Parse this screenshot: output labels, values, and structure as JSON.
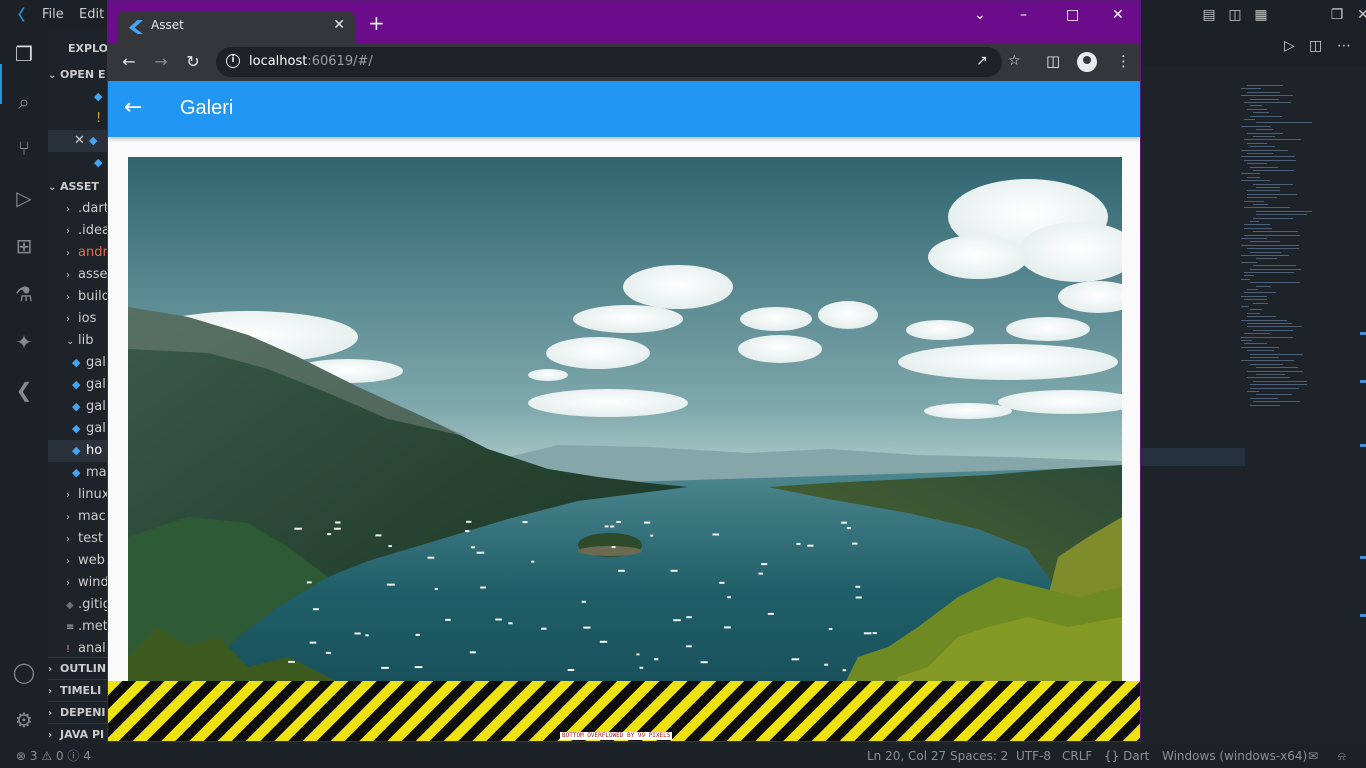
{
  "vscode": {
    "menu": [
      "File",
      "Edit"
    ],
    "explorer_title": "EXPLOR",
    "sections": {
      "open_editors": "OPEN E",
      "project": "ASSET",
      "outline": "OUTLIN",
      "timeline": "TIMELI",
      "dependencies": "DEPENI",
      "java_projects": "JAVA PI"
    },
    "tree": [
      {
        "label": ".dart",
        "kind": "folder"
      },
      {
        "label": ".idea",
        "kind": "folder"
      },
      {
        "label": "andr",
        "kind": "folder"
      },
      {
        "label": "asse",
        "kind": "folder"
      },
      {
        "label": "build",
        "kind": "folder"
      },
      {
        "label": "ios",
        "kind": "folder"
      },
      {
        "label": "lib",
        "kind": "folder-open"
      },
      {
        "label": "gal",
        "kind": "dart"
      },
      {
        "label": "gal",
        "kind": "dart"
      },
      {
        "label": "gal",
        "kind": "dart"
      },
      {
        "label": "gal",
        "kind": "dart"
      },
      {
        "label": "ho",
        "kind": "dart-selected"
      },
      {
        "label": "ma",
        "kind": "dart"
      },
      {
        "label": "linux",
        "kind": "folder"
      },
      {
        "label": "mac",
        "kind": "folder"
      },
      {
        "label": "test",
        "kind": "folder"
      },
      {
        "label": "web",
        "kind": "folder"
      },
      {
        "label": "wind",
        "kind": "folder"
      },
      {
        "label": ".gitig",
        "kind": "file"
      },
      {
        "label": ".met",
        "kind": "file"
      },
      {
        "label": "anal",
        "kind": "yaml"
      }
    ],
    "status": {
      "errors": "3",
      "warnings": "0",
      "info": "4",
      "cursor": "Ln 20, Col 27",
      "spaces": "Spaces: 2",
      "encoding": "UTF-8",
      "eol": "CRLF",
      "language": "Dart",
      "platform": "Windows (windows-x64)"
    }
  },
  "browser": {
    "tab_title": "Asset",
    "url_host": "localhost",
    "url_rest": ":60619/#/"
  },
  "app": {
    "title": "Galeri",
    "overflow_message": "BOTTOM OVERFLOWED BY 99 PIXELS"
  },
  "colors": {
    "appbar": "#2196f3",
    "browser_frame": "#6b0c8a",
    "overflow_yellow": "#eee212"
  }
}
